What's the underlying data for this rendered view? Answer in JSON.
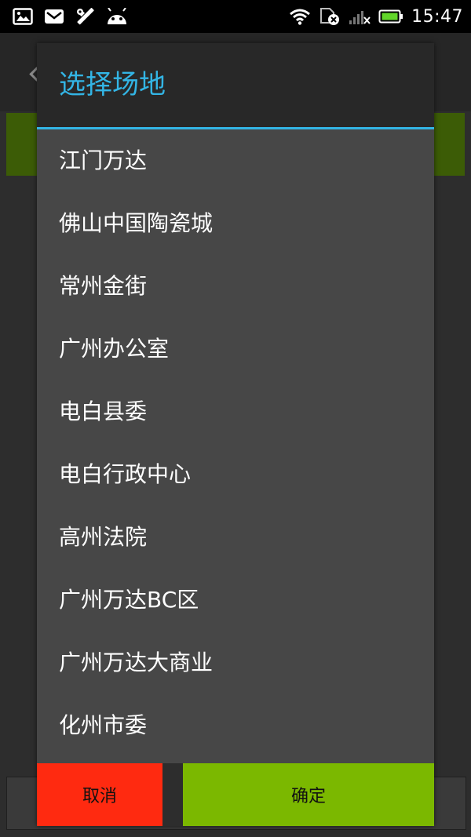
{
  "status_bar": {
    "time": "15:47",
    "left_icons": [
      "gallery-icon",
      "mail-icon",
      "tools-icon",
      "android-icon"
    ],
    "right_icons": [
      "wifi-icon",
      "sim-no-service-icon",
      "signal-icon",
      "battery-icon"
    ]
  },
  "dialog": {
    "title": "选择场地",
    "items": [
      "江门万达",
      "佛山中国陶瓷城",
      "常州金街",
      "广州办公室",
      "电白县委",
      "电白行政中心",
      "高州法院",
      "广州万达BC区",
      "广州万达大商业",
      "化州市委"
    ],
    "cancel_label": "取消",
    "confirm_label": "确定"
  },
  "colors": {
    "accent": "#33b5e5",
    "cancel": "#ff2a10",
    "confirm": "#7bb800"
  }
}
